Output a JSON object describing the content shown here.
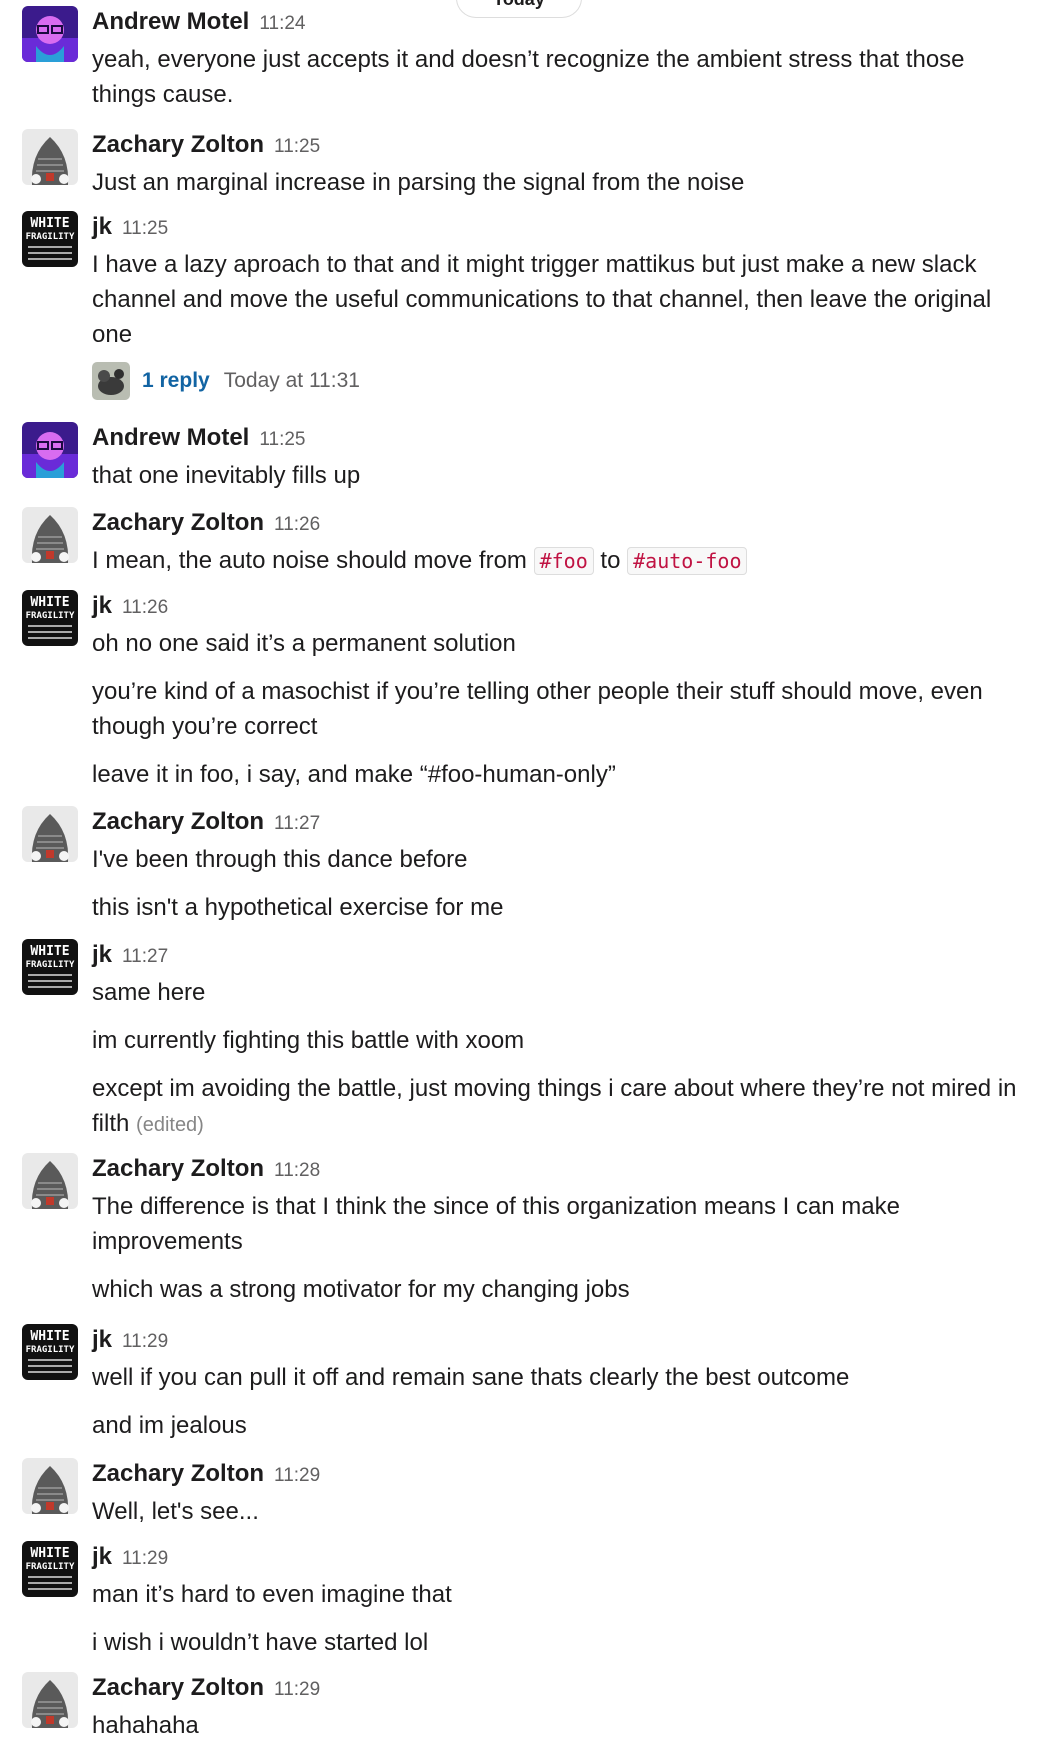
{
  "date_divider": "Today",
  "thread": {
    "reply_count": "1 reply",
    "reply_time": "Today at 11:31"
  },
  "colors": {
    "link": "#1264a3",
    "code_text": "#c01343",
    "timestamp": "#616061"
  },
  "groups": [
    {
      "author": "Andrew Motel",
      "time": "11:24",
      "avatar": "andrew-avatar",
      "messages": [
        "yeah, everyone just accepts it and doesn’t recognize the ambient stress that those things cause."
      ]
    },
    {
      "author": "Zachary Zolton",
      "time": "11:25",
      "avatar": "zachary-avatar",
      "messages": [
        "Just an marginal increase in parsing the signal from the noise"
      ]
    },
    {
      "author": "jk",
      "time": "11:25",
      "avatar": "jk-avatar",
      "messages": [
        "I have a lazy aproach to that and it might trigger mattikus but just make a new slack channel and move the useful communications to that channel, then leave the original one"
      ]
    },
    {
      "author": "Andrew Motel",
      "time": "11:25",
      "avatar": "andrew-avatar",
      "messages": [
        "that one inevitably fills up"
      ]
    },
    {
      "author": "Zachary Zolton",
      "time": "11:26",
      "avatar": "zachary-avatar",
      "messages": [],
      "rich": {
        "before": "I mean, the auto noise should move from ",
        "code1": "#foo",
        "middle": " to ",
        "code2": "#auto-foo"
      }
    },
    {
      "author": "jk",
      "time": "11:26",
      "avatar": "jk-avatar",
      "messages": [
        "oh no one said it’s a permanent solution",
        "you’re kind of a masochist if you’re telling other people their stuff should move, even though you’re correct",
        "leave it in foo, i say, and make “#foo-human-only”"
      ]
    },
    {
      "author": "Zachary Zolton",
      "time": "11:27",
      "avatar": "zachary-avatar",
      "messages": [
        "I've been through this dance before",
        "this isn't a hypothetical exercise for me"
      ]
    },
    {
      "author": "jk",
      "time": "11:27",
      "avatar": "jk-avatar",
      "messages": [
        "same here",
        "im currently fighting this battle with xoom",
        "except im avoiding the battle, just moving things i care about where they’re not mired in filth"
      ],
      "edited": "(edited)"
    },
    {
      "author": "Zachary Zolton",
      "time": "11:28",
      "avatar": "zachary-avatar",
      "messages": [
        "The difference is that I think the since of this organization means I can make improvements",
        "which was a strong motivator for my changing jobs"
      ]
    },
    {
      "author": "jk",
      "time": "11:29",
      "avatar": "jk-avatar",
      "messages": [
        "well if you can pull it off and remain sane thats clearly the best outcome",
        "and im jealous"
      ]
    },
    {
      "author": "Zachary Zolton",
      "time": "11:29",
      "avatar": "zachary-avatar",
      "messages": [
        "Well, let's see..."
      ]
    },
    {
      "author": "jk",
      "time": "11:29",
      "avatar": "jk-avatar",
      "messages": [
        "man it’s hard to even imagine that",
        "i wish i wouldn’t have started lol"
      ]
    },
    {
      "author": "Zachary Zolton",
      "time": "11:29",
      "avatar": "zachary-avatar",
      "messages": [
        "hahahaha"
      ]
    }
  ]
}
